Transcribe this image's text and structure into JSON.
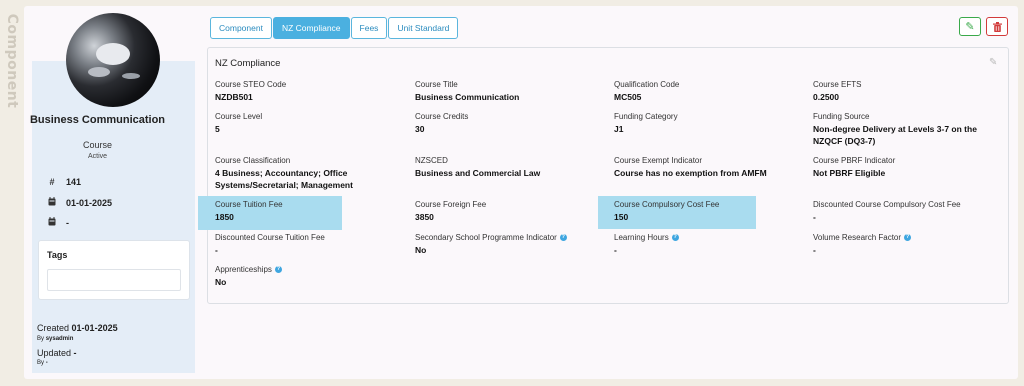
{
  "side_label": "Component",
  "sidebar": {
    "title": "Business Communication",
    "type": "Course",
    "status": "Active",
    "rows": [
      {
        "icon": "hash-icon",
        "value": "141"
      },
      {
        "icon": "calendar-icon",
        "value": "01-01-2025"
      },
      {
        "icon": "calendar-icon",
        "value": "-"
      }
    ],
    "tags_label": "Tags",
    "created_label": "Created",
    "created_date": "01-01-2025",
    "created_by_label": "By",
    "created_by": "sysadmin",
    "updated_label": "Updated",
    "updated_date": "-",
    "updated_by_label": "By",
    "updated_by": "-"
  },
  "tabs": [
    {
      "label": "Component",
      "active": false
    },
    {
      "label": "NZ Compliance",
      "active": true
    },
    {
      "label": "Fees",
      "active": false
    },
    {
      "label": "Unit Standard",
      "active": false
    }
  ],
  "panel": {
    "title": "NZ Compliance",
    "fields": [
      {
        "label": "Course STEO Code",
        "value": "NZDB501"
      },
      {
        "label": "Course Title",
        "value": "Business Communication"
      },
      {
        "label": "Qualification Code",
        "value": "MC505"
      },
      {
        "label": "Course EFTS",
        "value": "0.2500"
      },
      {
        "label": "Course Level",
        "value": "5"
      },
      {
        "label": "Course Credits",
        "value": "30"
      },
      {
        "label": "Funding Category",
        "value": "J1"
      },
      {
        "label": "Funding Source",
        "value": "Non-degree Delivery at Levels 3-7 on the NZQCF (DQ3-7)"
      },
      {
        "label": "Course Classification",
        "value": "4 Business; Accountancy; Office Systems/Secretarial; Management"
      },
      {
        "label": "NZSCED",
        "value": "Business and Commercial Law"
      },
      {
        "label": "Course Exempt Indicator",
        "value": "Course has no exemption from AMFM"
      },
      {
        "label": "Course PBRF Indicator",
        "value": "Not PBRF Eligible"
      },
      {
        "label": "Course Tuition Fee",
        "value": "1850"
      },
      {
        "label": "Course Foreign Fee",
        "value": "3850"
      },
      {
        "label": "Course Compulsory Cost Fee",
        "value": "150"
      },
      {
        "label": "Discounted Course Compulsory Cost Fee",
        "value": "-"
      },
      {
        "label": "Discounted Course Tuition Fee",
        "value": "-"
      },
      {
        "label": "Secondary School Programme Indicator",
        "value": "No"
      },
      {
        "label": "Learning Hours",
        "value": "-"
      },
      {
        "label": "Volume Research Factor",
        "value": "-"
      },
      {
        "label": "Apprenticeships",
        "value": "No"
      }
    ]
  },
  "colors": {
    "accent": "#4bb0e0",
    "highlight": "#a9dcef",
    "edit": "#3aa94a",
    "delete": "#d23b3b"
  }
}
